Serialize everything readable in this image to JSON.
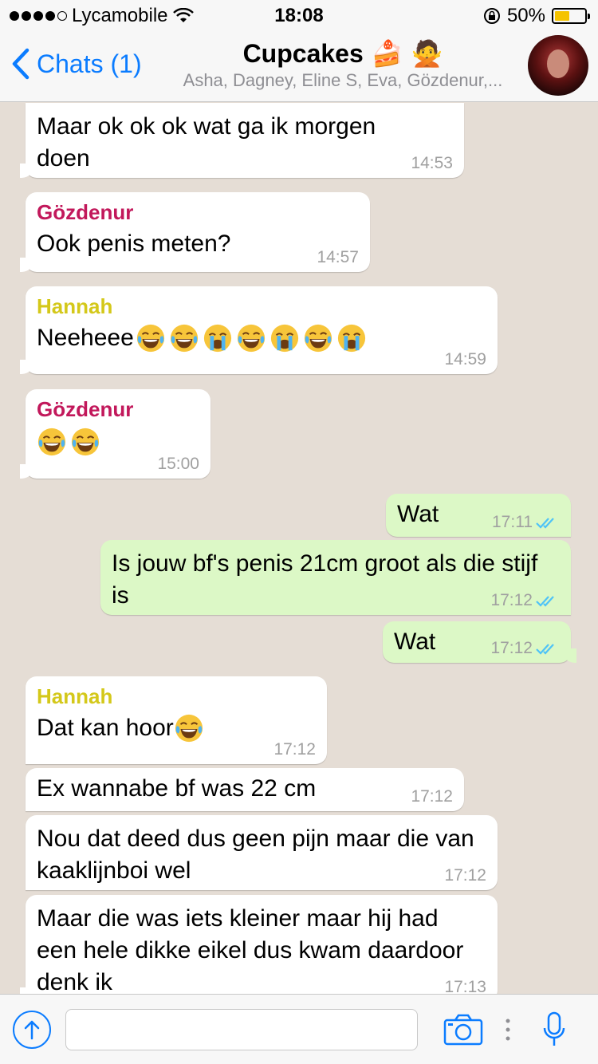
{
  "status_bar": {
    "carrier": "Lycamobile",
    "time": "18:08",
    "battery_percent": "50%",
    "battery_level": 0.5
  },
  "nav": {
    "back_label": "Chats (1)",
    "title": "Cupcakes",
    "title_emoji_1": "🍰",
    "title_emoji_2": "🙅",
    "subtitle": "Asha, Dagney, Eline S, Eva, Gözdenur,..."
  },
  "messages": [
    {
      "direction": "in",
      "sender": "",
      "text": "Maar ok ok ok wat ga ik morgen doen",
      "time": "14:53"
    },
    {
      "direction": "in",
      "sender": "Gözdenur",
      "sender_color": "#c2185b",
      "text": "Ook penis meten?",
      "time": "14:57"
    },
    {
      "direction": "in",
      "sender": "Hannah",
      "sender_color": "#d4c81a",
      "text": "Neeheee",
      "emojis": [
        "laughing-crying",
        "laughing-crying",
        "loudly-crying",
        "laughing-crying",
        "loudly-crying",
        "laughing-crying",
        "loudly-crying"
      ],
      "time": "14:59"
    },
    {
      "direction": "in",
      "sender": "Gözdenur",
      "sender_color": "#c2185b",
      "text": "",
      "emojis": [
        "laughing-crying",
        "laughing-crying"
      ],
      "time": "15:00"
    },
    {
      "direction": "out",
      "text": "Wat",
      "time": "17:11",
      "status": "read"
    },
    {
      "direction": "out",
      "text": "Is jouw bf's penis 21cm groot als die stijf is",
      "time": "17:12",
      "status": "read"
    },
    {
      "direction": "out",
      "text": "Wat",
      "time": "17:12",
      "status": "read"
    },
    {
      "direction": "in",
      "sender": "Hannah",
      "sender_color": "#d4c81a",
      "text": "Dat kan hoor",
      "emojis": [
        "laughing-crying"
      ],
      "time": "17:12"
    },
    {
      "direction": "in",
      "sender": "",
      "text": "Ex wannabe bf was 22 cm",
      "time": "17:12"
    },
    {
      "direction": "in",
      "sender": "",
      "text": "Nou dat deed dus geen pijn maar die van kaaklijnboi wel",
      "time": "17:12"
    },
    {
      "direction": "in",
      "sender": "",
      "text": "Maar die was iets kleiner maar hij had een hele dikke eikel dus kwam daardoor denk ik",
      "time": "17:13"
    }
  ],
  "input": {
    "placeholder": ""
  },
  "colors": {
    "accent": "#0b7cff",
    "outgoing_bubble": "#dcf8c6",
    "incoming_bubble": "#ffffff",
    "chat_background": "#e5ddd5",
    "read_ticks": "#4fc3f7"
  },
  "icons": [
    "wifi-icon",
    "lock-rotation-icon",
    "battery-icon",
    "back-chevron-icon",
    "upload-icon",
    "camera-icon",
    "more-icon",
    "microphone-icon"
  ]
}
